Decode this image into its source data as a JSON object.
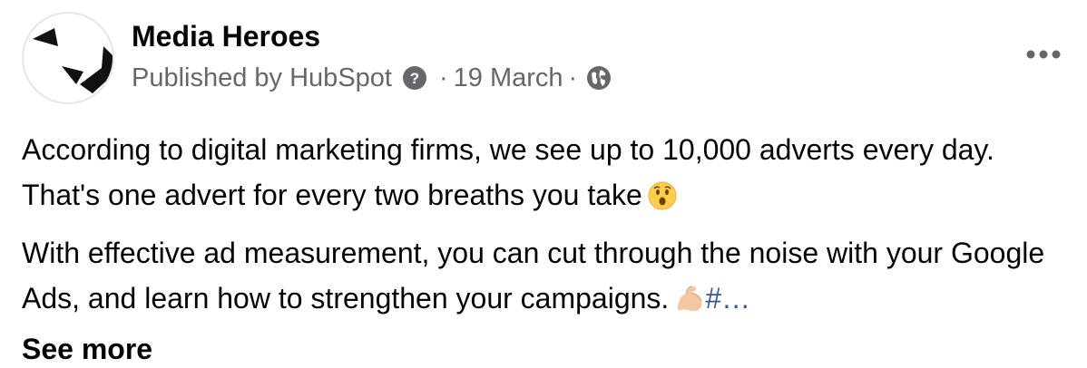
{
  "post": {
    "page_name": "Media Heroes",
    "publisher_label": "Published by HubSpot",
    "separator": "·",
    "date": "19 March",
    "help_icon": "question-mark-icon",
    "audience_icon": "globe-icon",
    "more_icon": "ellipsis-icon",
    "avatar_icon": "media-heroes-logo",
    "paragraph_1": "According to digital marketing firms, we see up to 10,000 adverts every day. That's one advert for every two breaths you take",
    "emoji_1": "hushed-face-emoji",
    "paragraph_2": "With effective ad measurement, you can cut through the noise with your Google Ads, and learn how to strengthen your campaigns.",
    "emoji_2": "flexed-biceps-emoji",
    "hashtag_truncated": "#…",
    "see_more_label": "See more"
  },
  "colors": {
    "primary_text": "#050505",
    "secondary_text": "#65676b",
    "hashtag": "#385898",
    "icon_grey": "#65676b"
  }
}
